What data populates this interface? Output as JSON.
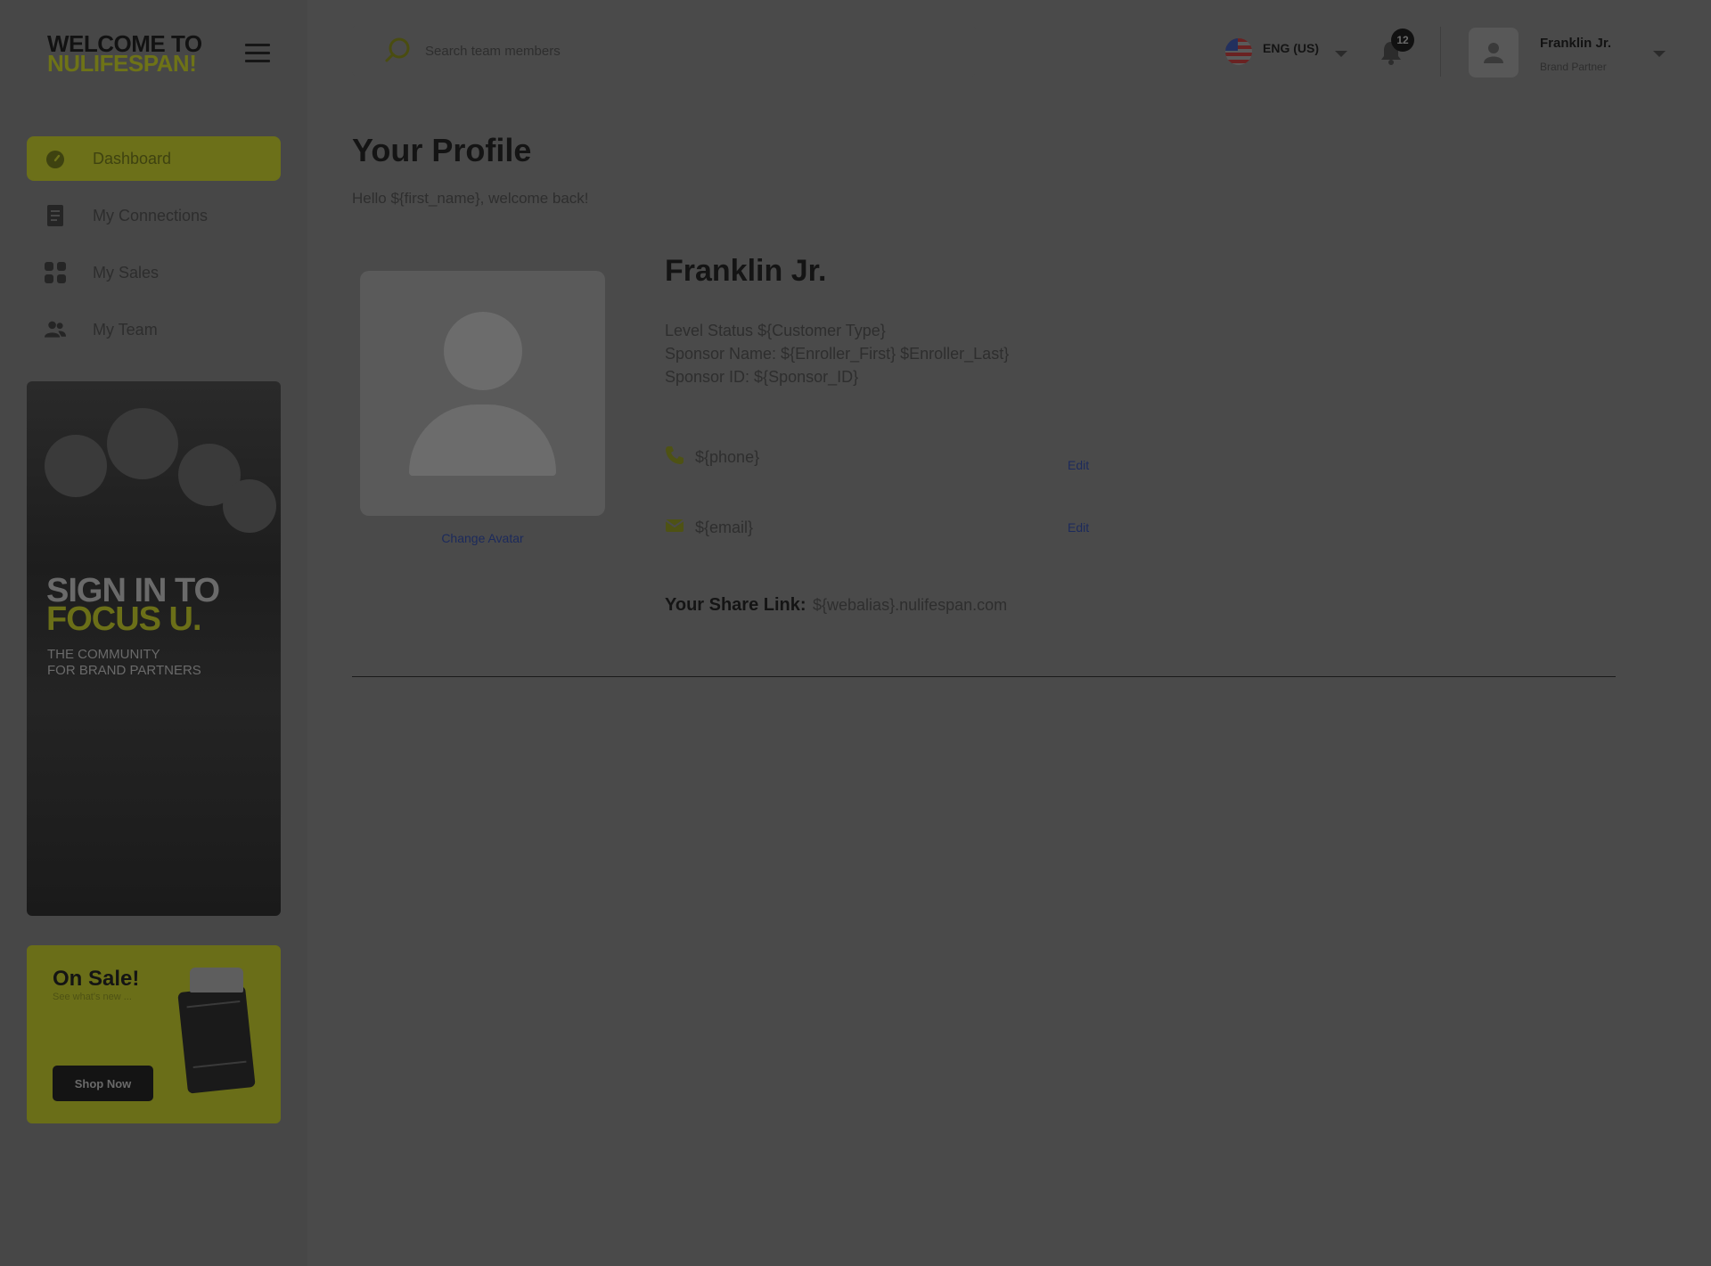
{
  "logo": {
    "line1": "WELCOME TO",
    "line2": "NULIFESPAN!"
  },
  "search": {
    "placeholder": "Search team members"
  },
  "language": {
    "label": "ENG (US)"
  },
  "notifications": {
    "count": "12"
  },
  "user": {
    "name": "Franklin Jr.",
    "role": "Brand Partner"
  },
  "sidebar": {
    "items": [
      {
        "label": "Dashboard",
        "icon": "dashboard-icon",
        "active": true
      },
      {
        "label": "My Connections",
        "icon": "document-icon"
      },
      {
        "label": "My Sales",
        "icon": "grid-icon"
      },
      {
        "label": "My Team",
        "icon": "team-icon"
      }
    ]
  },
  "banner_community": {
    "line1": "SIGN IN TO",
    "line2": "FOCUS U.",
    "line3": "THE COMMUNITY",
    "line4": "FOR BRAND PARTNERS"
  },
  "banner_sale": {
    "title": "On Sale!",
    "subtitle": "See what's new ...",
    "button": "Shop Now"
  },
  "profile": {
    "title": "Your Profile",
    "welcome": "Hello ${first_name}, welcome back!",
    "name": "Franklin Jr.",
    "level_status": "Level Status ${Customer Type}",
    "sponsor_name": "Sponsor Name: ${Enroller_First} $Enroller_Last}",
    "sponsor_id": "Sponsor ID: ${Sponsor_ID}",
    "change_avatar": "Change Avatar",
    "phone": "${phone}",
    "email": "${email}",
    "edit_label": "Edit",
    "share_label": "Your Share Link:",
    "share_value": "${webalias}.nulifespan.com"
  },
  "colors": {
    "accent": "#6c7019",
    "overlay_bg": "#4a4a4a",
    "link": "#1c2a5c"
  }
}
